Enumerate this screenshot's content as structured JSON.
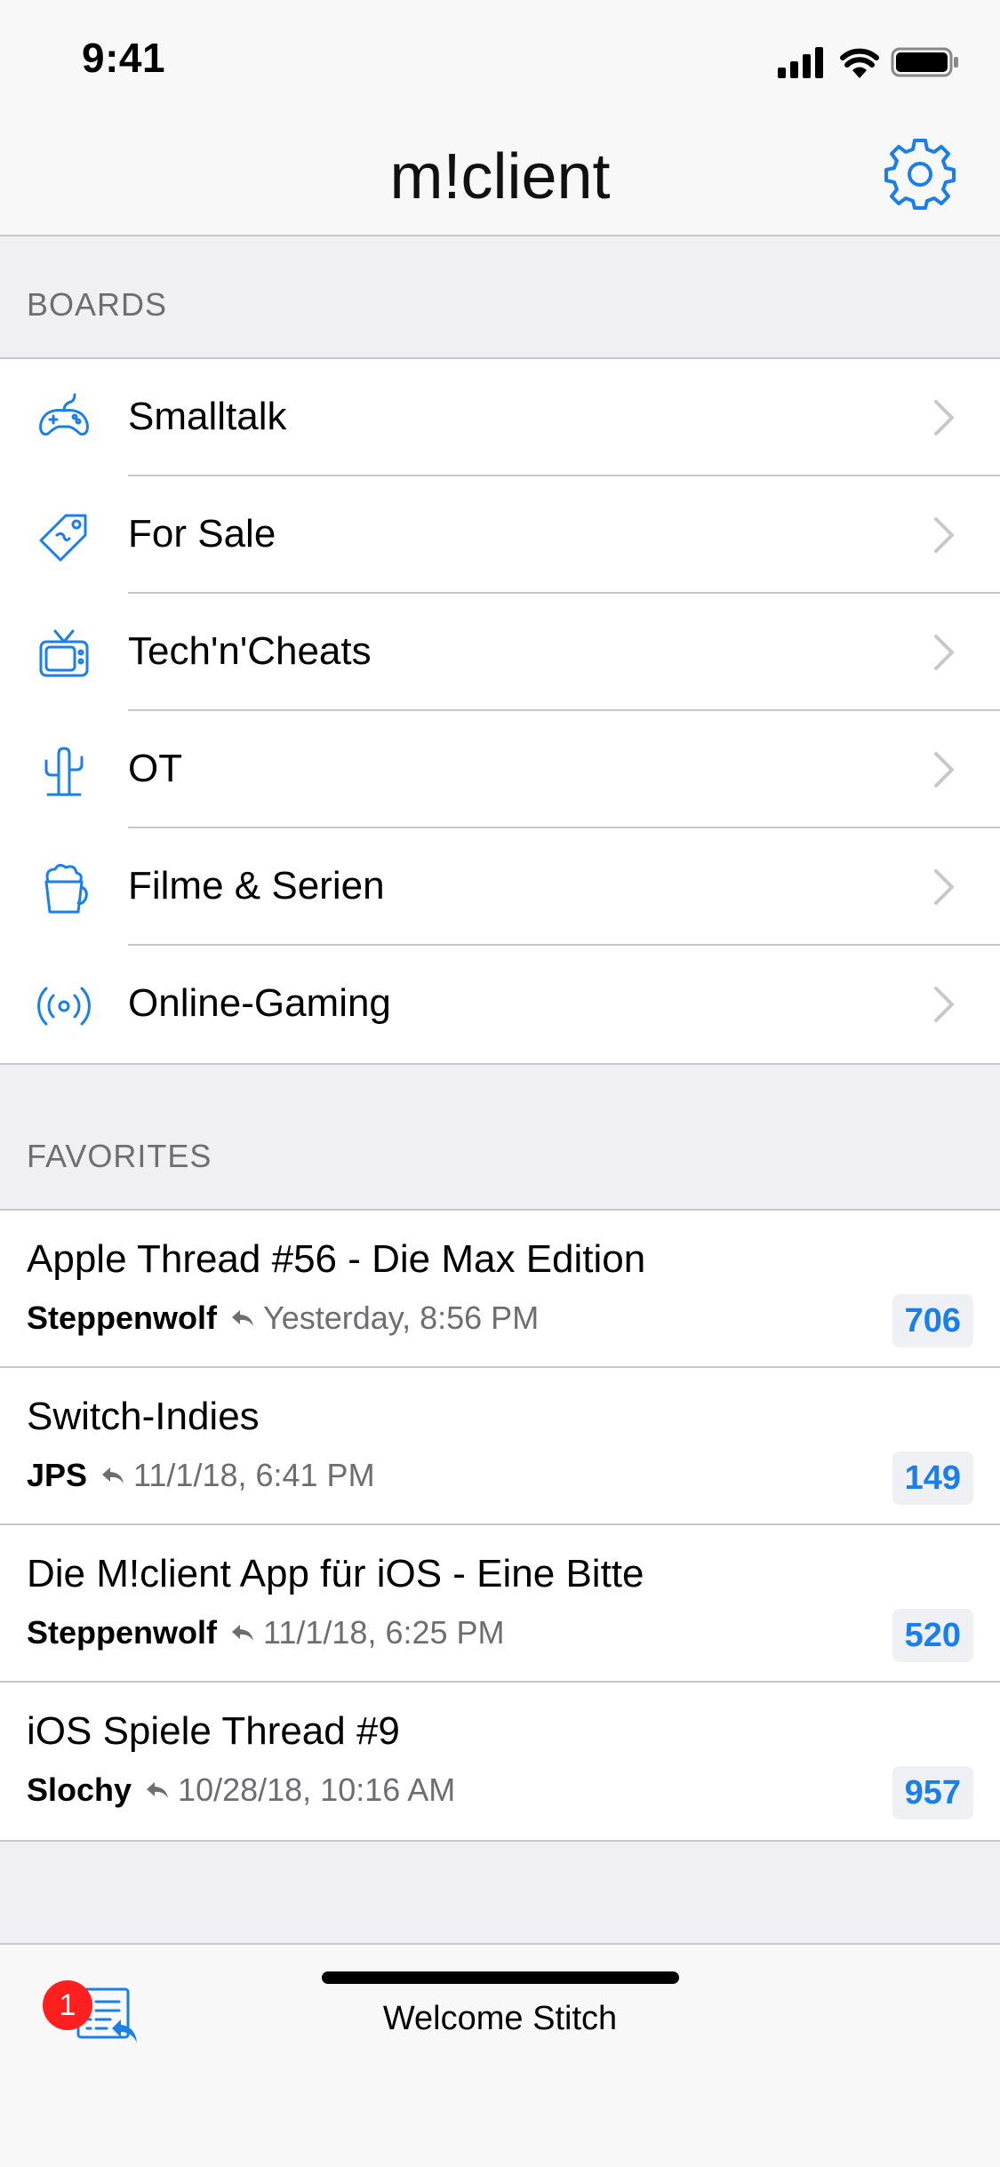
{
  "status_bar": {
    "time": "9:41"
  },
  "nav": {
    "title": "m!client",
    "settings_icon": "gear-icon"
  },
  "boards": {
    "header": "BOARDS",
    "items": [
      {
        "label": "Smalltalk",
        "icon": "gamepad-icon"
      },
      {
        "label": "For Sale",
        "icon": "price-tag-icon"
      },
      {
        "label": "Tech'n'Cheats",
        "icon": "tv-icon"
      },
      {
        "label": "OT",
        "icon": "cactus-icon"
      },
      {
        "label": "Filme & Serien",
        "icon": "popcorn-icon"
      },
      {
        "label": "Online-Gaming",
        "icon": "broadcast-icon"
      }
    ]
  },
  "favorites": {
    "header": "FAVORITES",
    "items": [
      {
        "title": "Apple Thread #56 - Die Max Edition",
        "author": "Steppenwolf",
        "time": "Yesterday, 8:56 PM",
        "count": "706"
      },
      {
        "title": "Switch-Indies",
        "author": "JPS",
        "time": "11/1/18, 6:41 PM",
        "count": "149"
      },
      {
        "title": "Die M!client App für iOS - Eine Bitte",
        "author": "Steppenwolf",
        "time": "11/1/18, 6:25 PM",
        "count": "520"
      },
      {
        "title": "iOS Spiele Thread #9",
        "author": "Slochy",
        "time": "10/28/18, 10:16 AM",
        "count": "957"
      }
    ]
  },
  "toolbar": {
    "badge": "1",
    "welcome": "Welcome Stitch"
  },
  "colors": {
    "accent": "#1a7fe6",
    "badge": "#ff1f1f",
    "background": "#efeff4"
  }
}
